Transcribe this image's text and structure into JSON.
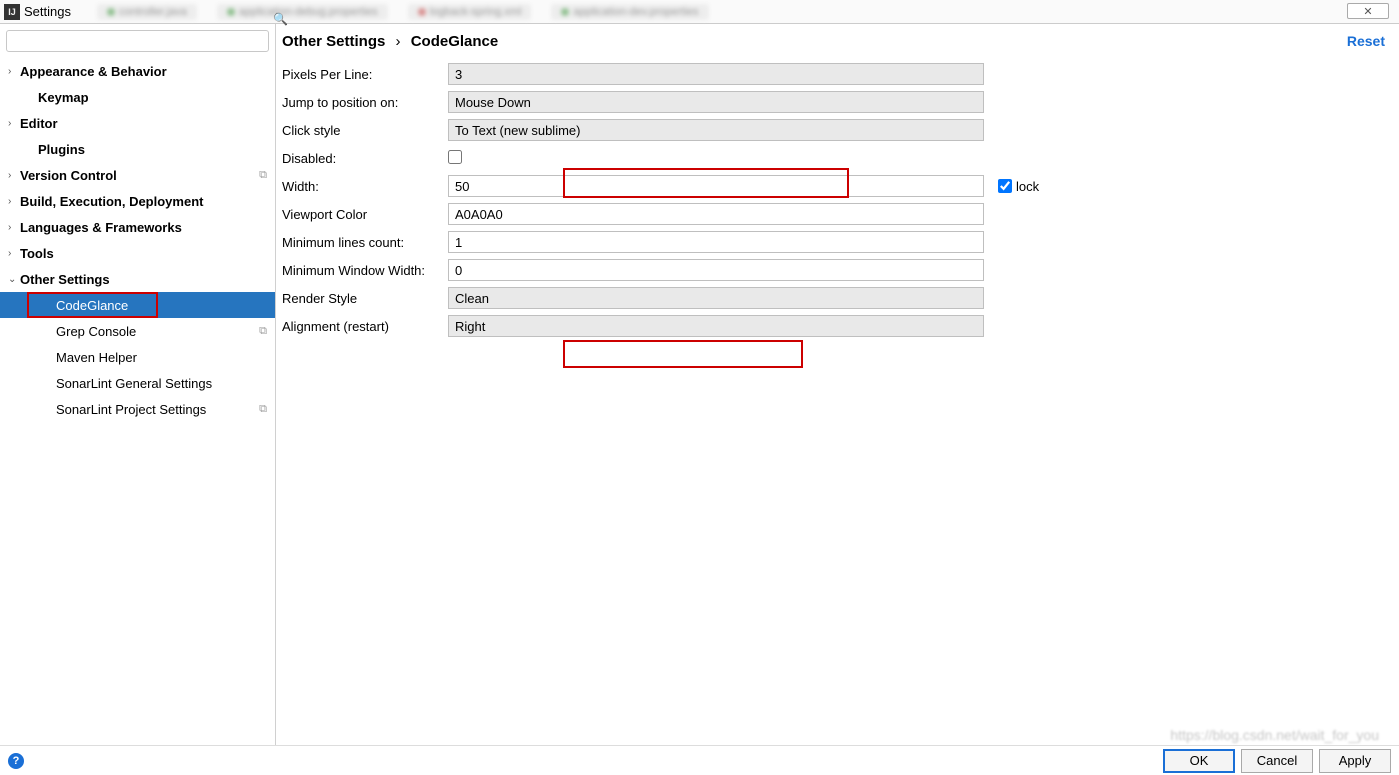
{
  "window": {
    "title": "Settings",
    "close_glyph": "✕"
  },
  "sidebar": {
    "search_placeholder": "",
    "items": [
      {
        "label": "Appearance & Behavior",
        "expandable": true,
        "bold": true
      },
      {
        "label": "Keymap",
        "bold": true,
        "indent": 1
      },
      {
        "label": "Editor",
        "expandable": true,
        "bold": true
      },
      {
        "label": "Plugins",
        "bold": true,
        "indent": 1
      },
      {
        "label": "Version Control",
        "expandable": true,
        "bold": true,
        "copy": true
      },
      {
        "label": "Build, Execution, Deployment",
        "expandable": true,
        "bold": true
      },
      {
        "label": "Languages & Frameworks",
        "expandable": true,
        "bold": true
      },
      {
        "label": "Tools",
        "expandable": true,
        "bold": true
      },
      {
        "label": "Other Settings",
        "expandable": true,
        "expanded": true,
        "bold": true
      },
      {
        "label": "CodeGlance",
        "indent": 2,
        "selected": true
      },
      {
        "label": "Grep Console",
        "indent": 2,
        "copy": true
      },
      {
        "label": "Maven Helper",
        "indent": 2
      },
      {
        "label": "SonarLint General Settings",
        "indent": 2
      },
      {
        "label": "SonarLint Project Settings",
        "indent": 2,
        "copy": true
      }
    ]
  },
  "breadcrumb": {
    "parent": "Other Settings",
    "current": "CodeGlance",
    "reset": "Reset"
  },
  "form": {
    "pixels_per_line": {
      "label": "Pixels Per Line:",
      "value": "3"
    },
    "jump_to": {
      "label": "Jump to position on:",
      "value": "Mouse Down"
    },
    "click_style": {
      "label": "Click style",
      "value": "To Text (new sublime)"
    },
    "disabled": {
      "label": "Disabled:",
      "checked": false
    },
    "width": {
      "label": "Width:",
      "value": "50",
      "lock_label": "lock",
      "lock_checked": true
    },
    "viewport_color": {
      "label": "Viewport Color",
      "value": "A0A0A0"
    },
    "min_lines": {
      "label": "Minimum lines count:",
      "value": "1"
    },
    "min_window_width": {
      "label": "Minimum Window Width:",
      "value": "0"
    },
    "render_style": {
      "label": "Render Style",
      "value": "Clean"
    },
    "alignment": {
      "label": "Alignment (restart)",
      "value": "Right"
    }
  },
  "footer": {
    "ok": "OK",
    "cancel": "Cancel",
    "apply": "Apply"
  }
}
